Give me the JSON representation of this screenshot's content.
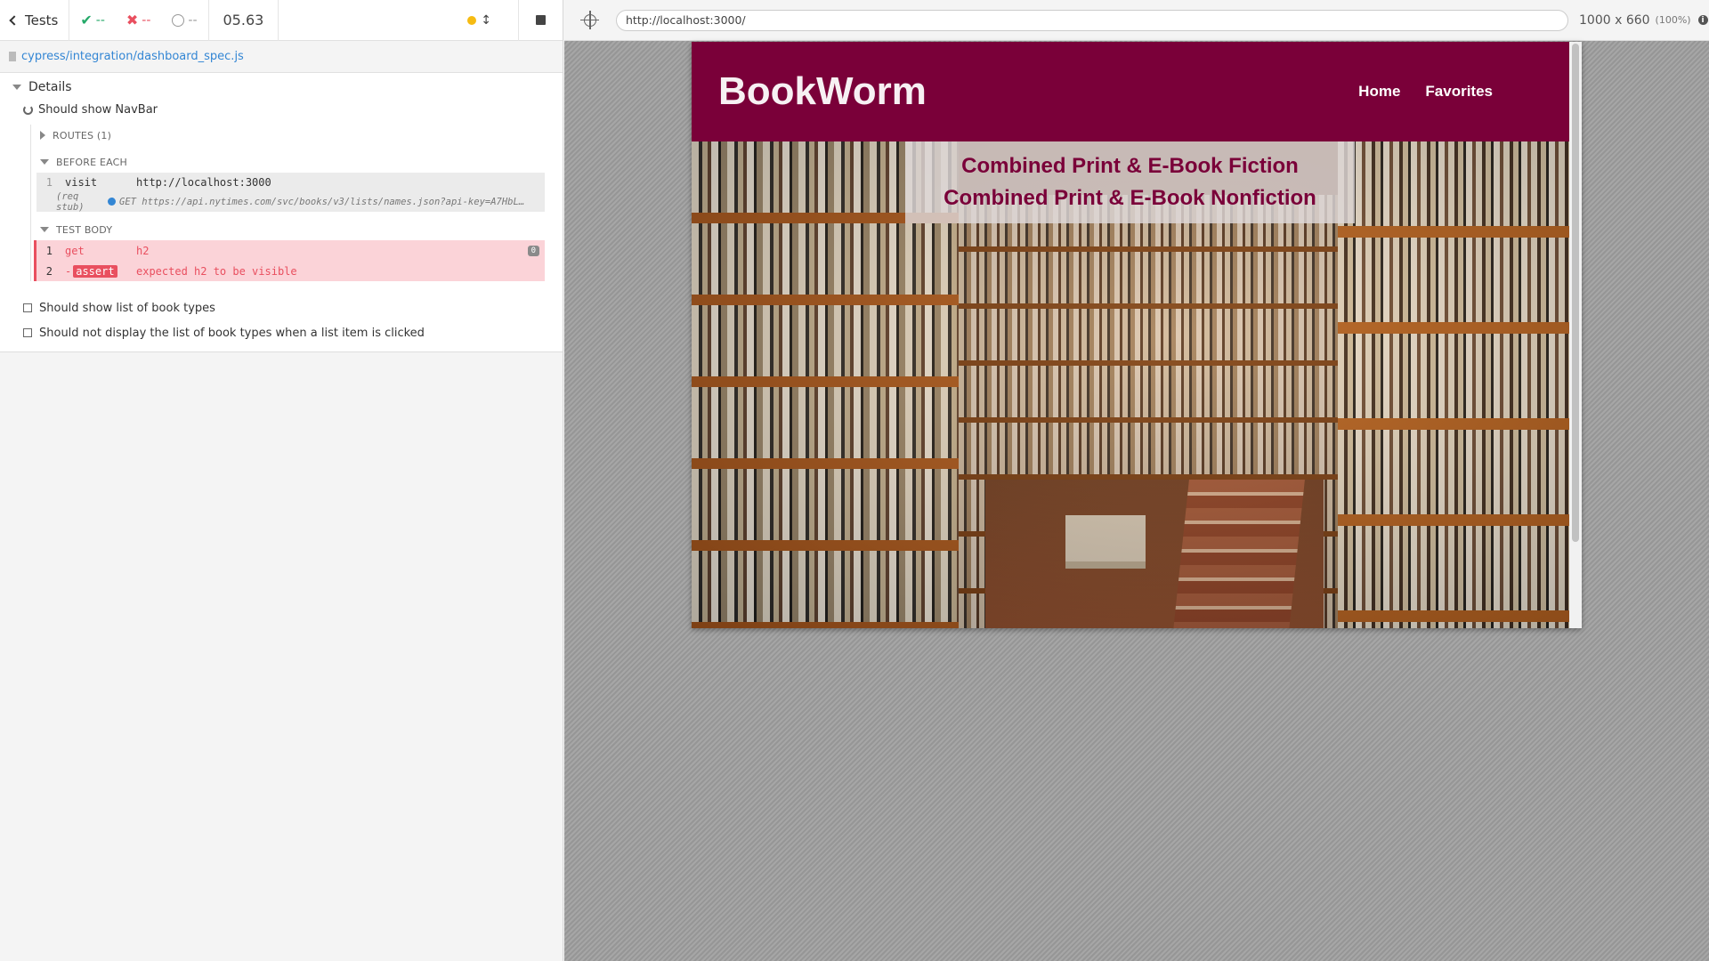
{
  "reporter": {
    "back_label": "Tests",
    "passed": "--",
    "failed": "--",
    "pending": "--",
    "duration": "05.63",
    "spec_path": "cypress/integration/dashboard_spec.js",
    "suite_title": "Details",
    "tests": [
      {
        "title": "Should show NavBar",
        "state": "running",
        "routes_label": "ROUTES (1)",
        "before_each_label": "BEFORE EACH",
        "before_each_cmds": [
          {
            "num": "1",
            "name": "visit",
            "msg": "http://localhost:3000"
          },
          {
            "num": "",
            "name": "(req stub)",
            "msg": "GET https://api.nytimes.com/svc/books/v3/lists/names.json?api-key=A7HbL…"
          }
        ],
        "test_body_label": "TEST BODY",
        "test_body_cmds": [
          {
            "num": "1",
            "name": "get",
            "msg": "h2",
            "badge": "0"
          },
          {
            "num": "2",
            "name": "-assert",
            "assert_tag": "assert",
            "msg": "expected h2 to be visible"
          }
        ]
      },
      {
        "title": "Should show list of book types",
        "state": "pending"
      },
      {
        "title": "Should not display the list of book types when a list item is clicked",
        "state": "pending"
      }
    ]
  },
  "aut": {
    "url": "http://localhost:3000/",
    "viewport": "1000 x 660",
    "scale": "(100%)",
    "info_icon": "i"
  },
  "app": {
    "logo": "BookWorm",
    "nav_links": [
      "Home",
      "Favorites"
    ],
    "lists": [
      "Combined Print & E-Book Fiction",
      "Combined Print & E-Book Nonfiction"
    ]
  },
  "colors": {
    "nav_bg": "#7a0039",
    "pass": "#25a969",
    "fail": "#e94f5f",
    "link": "#3386d4"
  }
}
